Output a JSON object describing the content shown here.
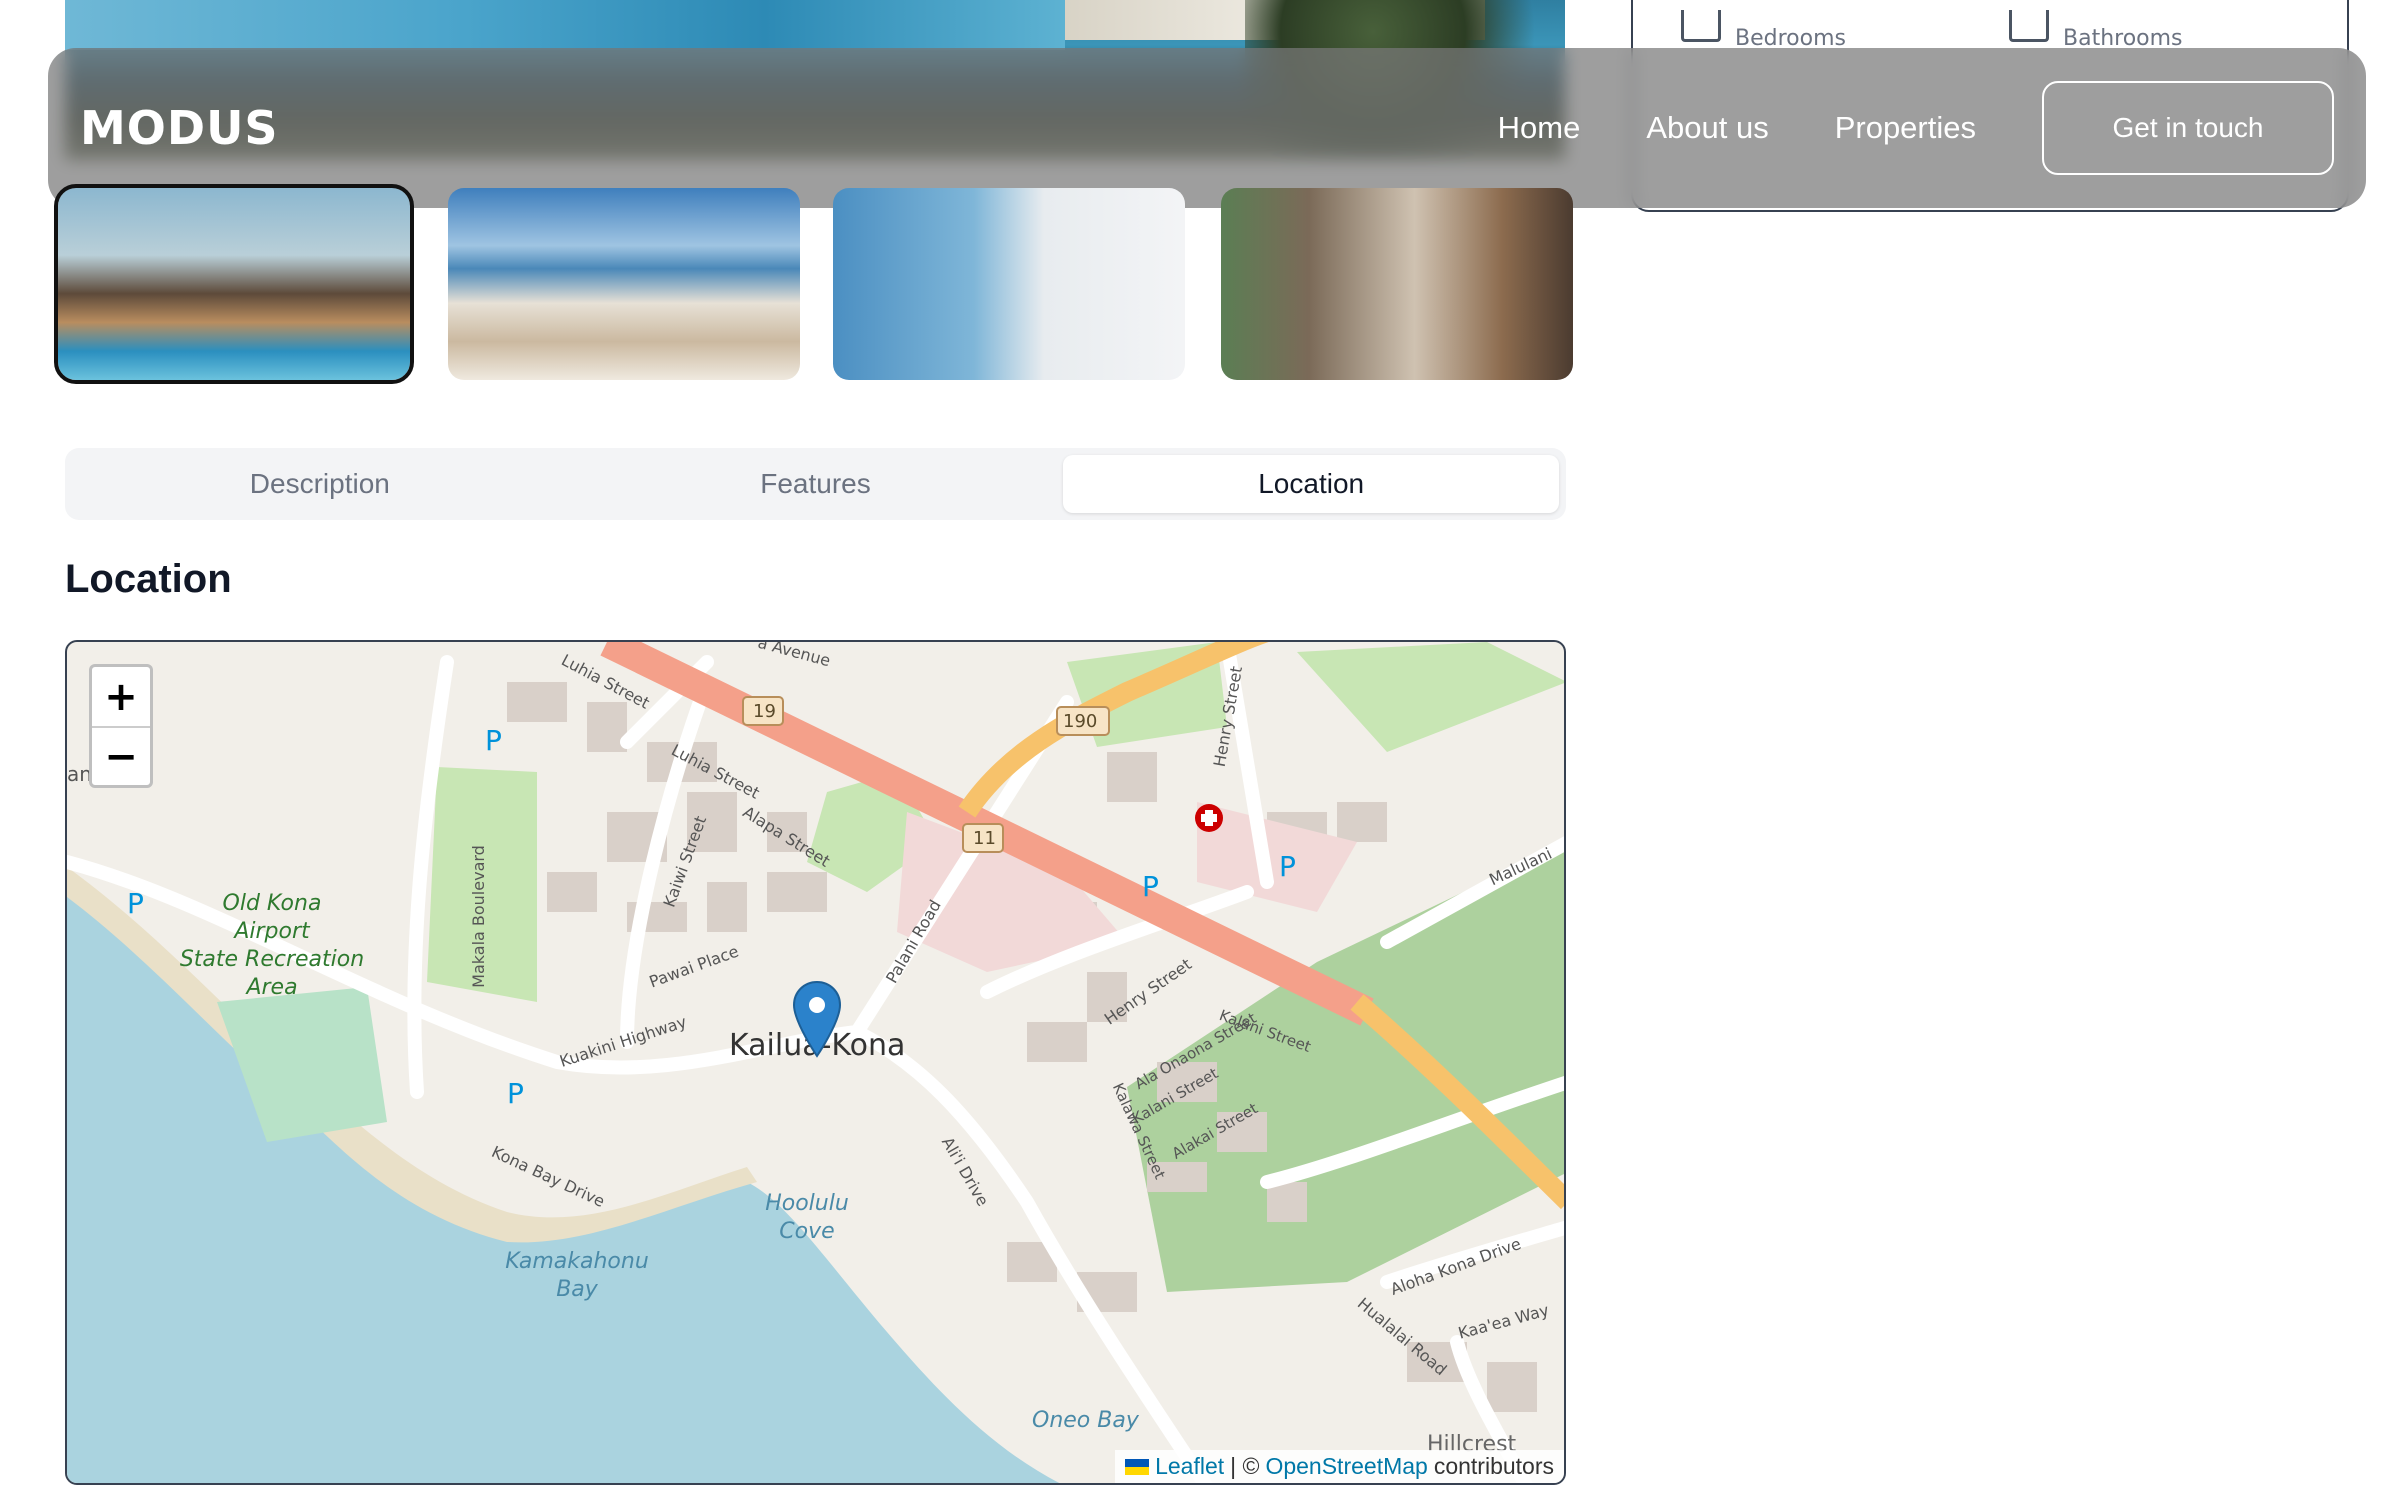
{
  "app": {
    "logo": "MODUS"
  },
  "nav": {
    "links": [
      {
        "label": "Home"
      },
      {
        "label": "About us"
      },
      {
        "label": "Properties"
      }
    ],
    "cta_label": "Get in touch"
  },
  "info_card": {
    "bedrooms_label": "Bedrooms",
    "bathrooms_label": "Bathrooms"
  },
  "gallery": {
    "thumbnail_count": 4,
    "active_index": 0
  },
  "tabs": [
    {
      "label": "Description",
      "active": false
    },
    {
      "label": "Features",
      "active": false
    },
    {
      "label": "Location",
      "active": true
    }
  ],
  "section": {
    "title": "Location"
  },
  "map": {
    "center_label": "Kailua-Kona",
    "zoom_in": "+",
    "zoom_out": "−",
    "attribution": {
      "leaflet": "Leaflet",
      "separator": "| ©",
      "osm": "OpenStreetMap",
      "suffix": "contributors"
    },
    "labels": {
      "park": "Old Kona Airport State Recreation Area",
      "park_line1": "Old Kona",
      "park_line2": "Airport",
      "park_line3": "State Recreation",
      "park_line4": "Area",
      "bay": "Kamakahonu",
      "bay2": "Bay",
      "cove": "Hoolulu",
      "cove2": "Cove",
      "oneo": "Oneo Bay",
      "hillcrest": "Hillcrest",
      "kaniakea": "aniākea",
      "kuakini": "Kuakini Highway",
      "palani": "Palani Road",
      "henry1": "Henry Street",
      "henry2": "Henry Street",
      "makala": "Makala Boulevard",
      "kona_bay": "Kona Bay Drive",
      "alii": "Ali'i Drive",
      "pawai": "Pawai Place",
      "kaiwi": "Kaiwi Street",
      "alapa": "Alapa Street",
      "luhia1": "Luhia Street",
      "luhia2": "Luhia Street",
      "aloha": "Aloha Kona Drive",
      "hualalai": "Hualalai Road",
      "kaaea": "Kaa'ea Way",
      "malulani": "Malulani",
      "avenue": "a Avenue",
      "ala_onaona": "Ala Onaona Street",
      "kalani1": "Kalani Street",
      "kalani2": "Kalani Street",
      "alakai": "Alakai Street",
      "kalawa": "Kalawa Street",
      "hwy19": "19",
      "hwy190": "190",
      "hwy11": "11",
      "parking": "P"
    }
  },
  "colors": {
    "accent": "#111827",
    "navbar_bg": "#787878",
    "highway": "#f4a08a",
    "trunk": "#f7c26b",
    "water": "#aad3df",
    "park": "#c8e6b4",
    "marker": "#2b82cb"
  }
}
